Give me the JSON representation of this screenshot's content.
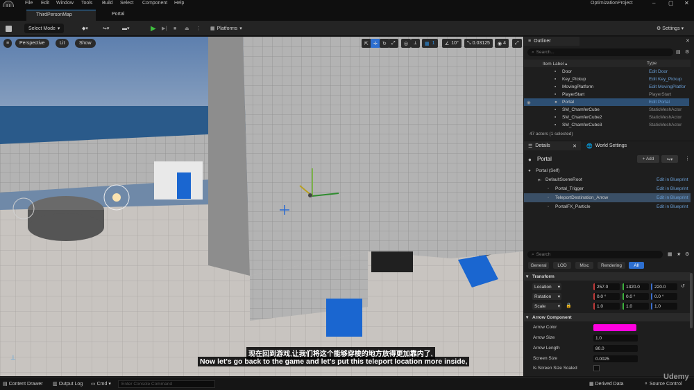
{
  "menu": [
    "File",
    "Edit",
    "Window",
    "Tools",
    "Build",
    "Select",
    "Component",
    "Help"
  ],
  "project_name": "OptimizationProject",
  "tabs": [
    {
      "label": "ThirdPersonMap"
    },
    {
      "label": "Portal"
    }
  ],
  "toolbar": {
    "select_mode": "Select Mode",
    "platforms": "Platforms",
    "settings": "Settings"
  },
  "viewport": {
    "perspective": "Perspective",
    "lit": "Lit",
    "show": "Show",
    "snap_grid": "1",
    "snap_angle": "10°",
    "snap_scale": "0.03125",
    "camera_speed": "4"
  },
  "subtitles": {
    "chinese": "现在回到游戏,让我们将这个能够穿梭的地方放得更加靠内了,",
    "english": "Now let's go back to the game and let's put this teleport location more inside,"
  },
  "watermark": "Udemy",
  "outliner": {
    "title": "Outliner",
    "search_placeholder": "Search...",
    "col_label": "Item Label ▴",
    "col_type": "Type",
    "rows": [
      {
        "name": "Door",
        "type": "Edit Door",
        "link": true
      },
      {
        "name": "Key_Pickup",
        "type": "Edit Key_Pickup",
        "link": true
      },
      {
        "name": "MovingPlatform",
        "type": "Edit MovingPlatfor",
        "link": true
      },
      {
        "name": "PlayerStart",
        "type": "PlayerStart",
        "link": false
      },
      {
        "name": "Portal",
        "type": "Edit Portal",
        "link": true,
        "selected": true
      },
      {
        "name": "SM_ChamferCube",
        "type": "StaticMeshActor",
        "link": false
      },
      {
        "name": "SM_ChamferCube2",
        "type": "StaticMeshActor",
        "link": false
      },
      {
        "name": "SM_ChamferCube3",
        "type": "StaticMeshActor",
        "link": false
      }
    ],
    "actor_count": "47 actors (1 selected)"
  },
  "details": {
    "tab_details": "Details",
    "tab_world": "World Settings",
    "actor_name": "Portal",
    "add_button": "+ Add",
    "components": [
      {
        "name": "Portal (Self)",
        "bp": "",
        "indent": 0
      },
      {
        "name": "DefaultSceneRoot",
        "bp": "Edit in Blueprint",
        "indent": 1
      },
      {
        "name": "Portal_Trigger",
        "bp": "Edit in Blueprint",
        "indent": 2
      },
      {
        "name": "TeleportDestination_Arrow",
        "bp": "Edit in Blueprint",
        "indent": 2,
        "selected": true
      },
      {
        "name": "PortalFX_Particle",
        "bp": "Edit in Blueprint",
        "indent": 2
      }
    ],
    "search_placeholder": "Search",
    "filters": [
      "General",
      "LOD",
      "Misc",
      "Rendering",
      "All"
    ],
    "transform_title": "Transform",
    "location_label": "Location",
    "location": [
      "257.0",
      "1320.0",
      "220.0"
    ],
    "rotation_label": "Rotation",
    "rotation": [
      "0.0 °",
      "0.0 °",
      "0.0 °"
    ],
    "scale_label": "Scale",
    "scale": [
      "1.0",
      "1.0",
      "1.0"
    ],
    "arrow_title": "Arrow Component",
    "arrow_color_label": "Arrow Color",
    "arrow_color": "#ff00e0",
    "arrow_size_label": "Arrow Size",
    "arrow_size": "1.0",
    "arrow_length_label": "Arrow Length",
    "arrow_length": "80.0",
    "screen_size_label": "Screen Size",
    "screen_size": "0.0025",
    "screen_scaled_label": "Is Screen Size Scaled"
  },
  "statusbar": {
    "content_drawer": "Content Drawer",
    "output_log": "Output Log",
    "cmd": "Cmd",
    "console_placeholder": "Enter Console Command",
    "derived_data": "Derived Data",
    "source_control": "Source Control"
  }
}
